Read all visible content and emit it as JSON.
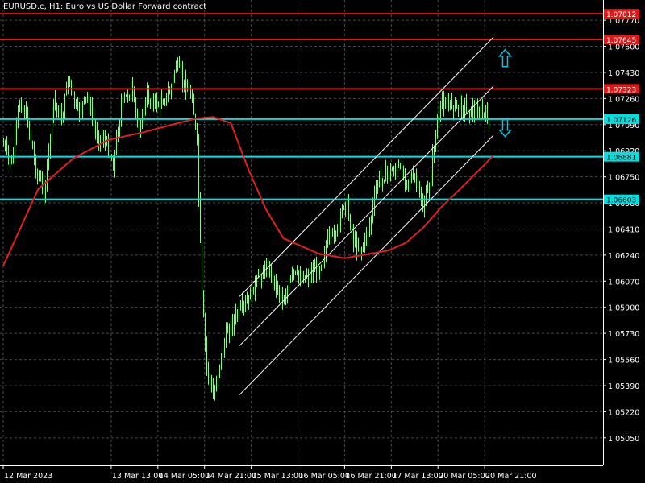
{
  "header": {
    "title": "EURUSD.c, H1:  Euro vs US Dollar Forward contract"
  },
  "chart_data": {
    "type": "candlestick",
    "title": "EURUSD.c, H1:  Euro vs US Dollar Forward contract",
    "symbol": "EURUSD.c",
    "timeframe": "H1",
    "description": "Euro vs US Dollar Forward contract",
    "background": "#000000",
    "grid": true,
    "colors": {
      "candle": "#90ee90",
      "ma": "#e02020",
      "resistance": "#e01818",
      "support": "#00e0e0",
      "channel": "#ffffff",
      "arrow": "#00c8e8",
      "grid": "#4a4a4a",
      "axis_text": "#ffffff"
    },
    "ylim": [
      1.0496,
      1.07844
    ],
    "y_ticks": [
      "1.07770",
      "1.07600",
      "1.07430",
      "1.07260",
      "1.07090",
      "1.06920",
      "1.06750",
      "1.06580",
      "1.06410",
      "1.06240",
      "1.06070",
      "1.05900",
      "1.05730",
      "1.05560",
      "1.05390",
      "1.05220",
      "1.05050"
    ],
    "x_ticks": [
      "12 Mar 2023",
      "13 Mar 13:00",
      "14 Mar 05:00",
      "14 Mar 21:00",
      "15 Mar 13:00",
      "16 Mar 05:00",
      "16 Mar 21:00",
      "17 Mar 13:00",
      "20 Mar 05:00",
      "20 Mar 21:00"
    ],
    "horizontal_levels": [
      {
        "label": "1.07812",
        "value": 1.07812,
        "color": "#e01818"
      },
      {
        "label": "1.07645",
        "value": 1.07645,
        "color": "#e01818"
      },
      {
        "label": "1.07323",
        "value": 1.07323,
        "color": "#e01818"
      },
      {
        "label": "1.07126",
        "value": 1.07126,
        "color": "#00e0e0"
      },
      {
        "label": "1.06881",
        "value": 1.06881,
        "color": "#00e0e0"
      },
      {
        "label": "1.06603",
        "value": 1.06603,
        "color": "#00e0e0"
      }
    ],
    "channel_lines": [
      {
        "x": [
          "15 Mar 09:00",
          "21 Mar 00:00"
        ],
        "y": [
          1.0597,
          1.0766
        ]
      },
      {
        "x": [
          "15 Mar 09:00",
          "21 Mar 00:00"
        ],
        "y": [
          1.0565,
          1.0734
        ]
      },
      {
        "x": [
          "15 Mar 09:00",
          "21 Mar 00:00"
        ],
        "y": [
          1.0533,
          1.0702
        ]
      }
    ],
    "arrows": [
      {
        "direction": "up",
        "x": "21 Mar 04:00",
        "y": 1.0752
      },
      {
        "direction": "down",
        "x": "21 Mar 04:00",
        "y": 1.0707
      }
    ],
    "series": [
      {
        "type": "ma",
        "x": [
          "12 Mar 2023",
          "12 Mar 12:00",
          "13 Mar 00:00",
          "13 Mar 12:00",
          "14 Mar 00:00",
          "14 Mar 12:00",
          "14 Mar 18:00",
          "15 Mar 00:00",
          "15 Mar 06:00",
          "15 Mar 12:00",
          "15 Mar 18:00",
          "16 Mar 00:00",
          "16 Mar 12:00",
          "16 Mar 21:00",
          "17 Mar 06:00",
          "17 Mar 12:00",
          "17 Mar 18:00",
          "20 Mar 00:00",
          "20 Mar 06:00",
          "20 Mar 12:00",
          "20 Mar 21:00",
          "21 Mar 00:00"
        ],
        "values": [
          1.0617,
          1.0667,
          1.0687,
          1.0699,
          1.0704,
          1.071,
          1.0713,
          1.0714,
          1.071,
          1.068,
          1.0654,
          1.0635,
          1.0625,
          1.0622,
          1.0625,
          1.0627,
          1.0632,
          1.0642,
          1.0655,
          1.0666,
          1.0683,
          1.0689
        ]
      }
    ]
  }
}
